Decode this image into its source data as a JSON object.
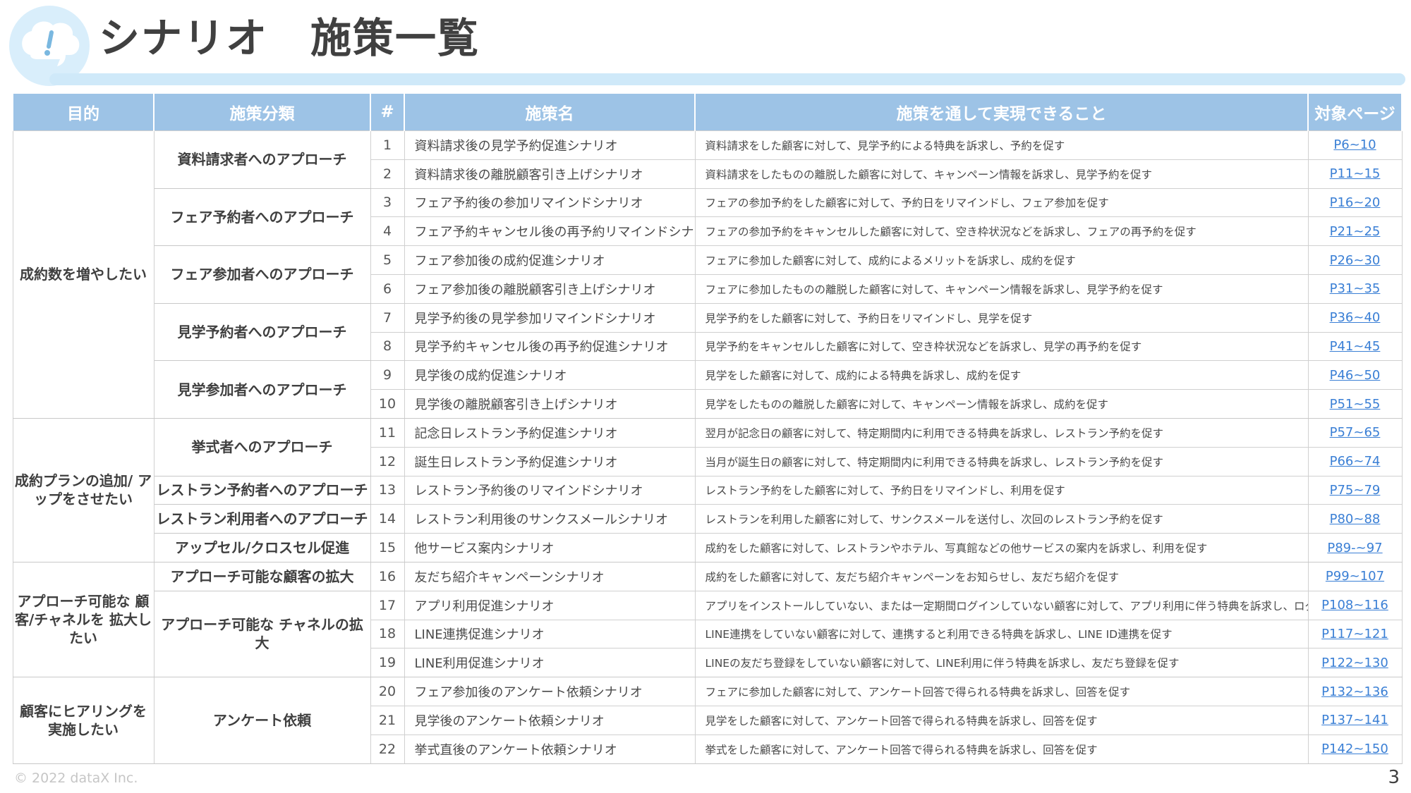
{
  "header": {
    "title": "シナリオ　施策一覧",
    "icon": "speech-bubble-exclamation-icon",
    "accent_color": "#cfe9f9"
  },
  "table": {
    "columns": [
      "目的",
      "施策分類",
      "#",
      "施策名",
      "施策を通して実現できること",
      "対象ページ"
    ],
    "goals": [
      {
        "label": "成約数を増やしたい",
        "rowspan": 10
      },
      {
        "label": "成約プランの追加/\nアップをさせたい",
        "rowspan": 5
      },
      {
        "label": "アプローチ可能な\n顧客/チャネルを\n拡大したい",
        "rowspan": 4
      },
      {
        "label": "顧客にヒアリングを\n実施したい",
        "rowspan": 3
      }
    ],
    "categories": [
      {
        "label": "資料請求者へのアプローチ",
        "rowspan": 2
      },
      {
        "label": "フェア予約者へのアプローチ",
        "rowspan": 2
      },
      {
        "label": "フェア参加者へのアプローチ",
        "rowspan": 2
      },
      {
        "label": "見学予約者へのアプローチ",
        "rowspan": 2
      },
      {
        "label": "見学参加者へのアプローチ",
        "rowspan": 2
      },
      {
        "label": "挙式者へのアプローチ",
        "rowspan": 2
      },
      {
        "label": "レストラン予約者へのアプローチ",
        "rowspan": 1
      },
      {
        "label": "レストラン利用者へのアプローチ",
        "rowspan": 1
      },
      {
        "label": "アップセル/クロスセル促進",
        "rowspan": 1
      },
      {
        "label": "アプローチ可能な顧客の拡大",
        "rowspan": 1
      },
      {
        "label": "アプローチ可能な\nチャネルの拡大",
        "rowspan": 3
      },
      {
        "label": "アンケート依頼",
        "rowspan": 3
      }
    ],
    "rows": [
      {
        "num": "1",
        "name": "資料請求後の見学予約促進シナリオ",
        "desc": "資料請求をした顧客に対して、見学予約による特典を訴求し、予約を促す",
        "page": "P6~10"
      },
      {
        "num": "2",
        "name": "資料請求後の離脱顧客引き上げシナリオ",
        "desc": "資料請求をしたものの離脱した顧客に対して、キャンペーン情報を訴求し、見学予約を促す",
        "page": "P11~15"
      },
      {
        "num": "3",
        "name": "フェア予約後の参加リマインドシナリオ",
        "desc": "フェアの参加予約をした顧客に対して、予約日をリマインドし、フェア参加を促す",
        "page": "P16~20"
      },
      {
        "num": "4",
        "name": "フェア予約キャンセル後の再予約リマインドシナリオ",
        "desc": "フェアの参加予約をキャンセルした顧客に対して、空き枠状況などを訴求し、フェアの再予約を促す",
        "page": "P21~25"
      },
      {
        "num": "5",
        "name": "フェア参加後の成約促進シナリオ",
        "desc": "フェアに参加した顧客に対して、成約によるメリットを訴求し、成約を促す",
        "page": "P26~30"
      },
      {
        "num": "6",
        "name": "フェア参加後の離脱顧客引き上げシナリオ",
        "desc": "フェアに参加したものの離脱した顧客に対して、キャンペーン情報を訴求し、見学予約を促す",
        "page": "P31~35"
      },
      {
        "num": "7",
        "name": "見学予約後の見学参加リマインドシナリオ",
        "desc": "見学予約をした顧客に対して、予約日をリマインドし、見学を促す",
        "page": "P36~40"
      },
      {
        "num": "8",
        "name": "見学予約キャンセル後の再予約促進シナリオ",
        "desc": "見学予約をキャンセルした顧客に対して、空き枠状況などを訴求し、見学の再予約を促す",
        "page": "P41~45"
      },
      {
        "num": "9",
        "name": "見学後の成約促進シナリオ",
        "desc": "見学をした顧客に対して、成約による特典を訴求し、成約を促す",
        "page": "P46~50"
      },
      {
        "num": "10",
        "name": "見学後の離脱顧客引き上げシナリオ",
        "desc": "見学をしたものの離脱した顧客に対して、キャンペーン情報を訴求し、成約を促す",
        "page": "P51~55"
      },
      {
        "num": "11",
        "name": "記念日レストラン予約促進シナリオ",
        "desc": "翌月が記念日の顧客に対して、特定期間内に利用できる特典を訴求し、レストラン予約を促す",
        "page": "P57~65"
      },
      {
        "num": "12",
        "name": "誕生日レストラン予約促進シナリオ",
        "desc": "当月が誕生日の顧客に対して、特定期間内に利用できる特典を訴求し、レストラン予約を促す",
        "page": "P66~74"
      },
      {
        "num": "13",
        "name": "レストラン予約後のリマインドシナリオ",
        "desc": "レストラン予約をした顧客に対して、予約日をリマインドし、利用を促す",
        "page": "P75~79"
      },
      {
        "num": "14",
        "name": "レストラン利用後のサンクスメールシナリオ",
        "desc": "レストランを利用した顧客に対して、サンクスメールを送付し、次回のレストラン予約を促す",
        "page": "P80~88"
      },
      {
        "num": "15",
        "name": "他サービス案内シナリオ",
        "desc": "成約をした顧客に対して、レストランやホテル、写真館などの他サービスの案内を訴求し、利用を促す",
        "page": "P89-~97"
      },
      {
        "num": "16",
        "name": "友だち紹介キャンペーンシナリオ",
        "desc": "成約をした顧客に対して、友だち紹介キャンペーンをお知らせし、友だち紹介を促す",
        "page": "P99~107"
      },
      {
        "num": "17",
        "name": "アプリ利用促進シナリオ",
        "desc": "アプリをインストールしていない、または一定期間ログインしていない顧客に対して、アプリ利用に伴う特典を訴求し、ログインを促す",
        "page": "P108~116"
      },
      {
        "num": "18",
        "name": "LINE連携促進シナリオ",
        "desc": "LINE連携をしていない顧客に対して、連携すると利用できる特典を訴求し、LINE ID連携を促す",
        "page": "P117~121"
      },
      {
        "num": "19",
        "name": "LINE利用促進シナリオ",
        "desc": "LINEの友だち登録をしていない顧客に対して、LINE利用に伴う特典を訴求し、友だち登録を促す",
        "page": "P122~130"
      },
      {
        "num": "20",
        "name": "フェア参加後のアンケート依頼シナリオ",
        "desc": "フェアに参加した顧客に対して、アンケート回答で得られる特典を訴求し、回答を促す",
        "page": "P132~136"
      },
      {
        "num": "21",
        "name": "見学後のアンケート依頼シナリオ",
        "desc": "見学をした顧客に対して、アンケート回答で得られる特典を訴求し、回答を促す",
        "page": "P137~141"
      },
      {
        "num": "22",
        "name": "挙式直後のアンケート依頼シナリオ",
        "desc": "挙式をした顧客に対して、アンケート回答で得られる特典を訴求し、回答を促す",
        "page": "P142~150"
      }
    ]
  },
  "footer": {
    "copyright": "© 2022 dataX Inc.",
    "page_number": "3"
  }
}
